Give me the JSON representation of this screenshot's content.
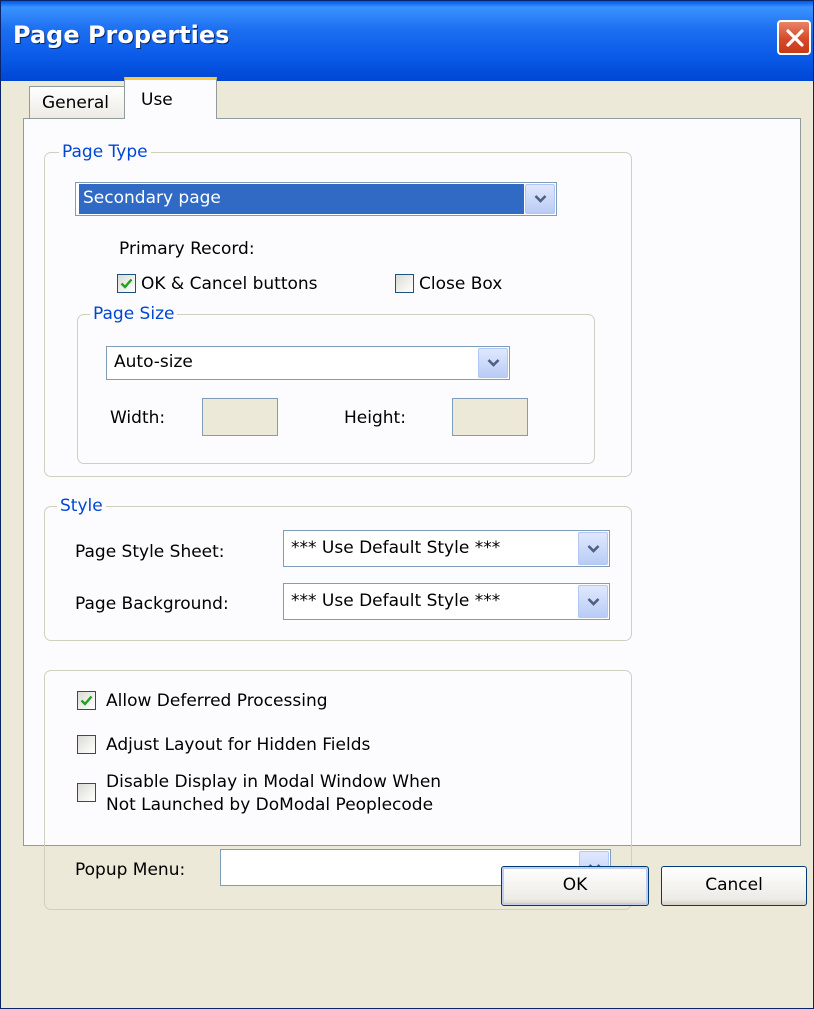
{
  "window": {
    "title": "Page Properties"
  },
  "tabs": {
    "general": "General",
    "use": "Use"
  },
  "page_type": {
    "legend": "Page Type",
    "type_value": "Secondary page",
    "primary_record_label": "Primary Record:",
    "ok_cancel_label": "OK & Cancel buttons",
    "ok_cancel_checked": true,
    "close_box_label": "Close Box",
    "close_box_checked": false
  },
  "page_size": {
    "legend": "Page Size",
    "size_value": "Auto-size",
    "width_label": "Width:",
    "height_label": "Height:",
    "width_value": "",
    "height_value": ""
  },
  "style": {
    "legend": "Style",
    "style_sheet_label": "Page Style Sheet:",
    "style_sheet_value": "*** Use Default Style ***",
    "background_label": "Page Background:",
    "background_value": "*** Use Default Style ***"
  },
  "options": {
    "allow_deferred_label": "Allow Deferred Processing",
    "allow_deferred_checked": true,
    "adjust_layout_label": "Adjust Layout for Hidden Fields",
    "adjust_layout_checked": false,
    "disable_modal_line1": "Disable Display in Modal Window When",
    "disable_modal_line2": "Not Launched by DoModal Peoplecode",
    "disable_modal_checked": false,
    "popup_menu_label": "Popup Menu:",
    "popup_menu_value": ""
  },
  "buttons": {
    "ok": "OK",
    "cancel": "Cancel"
  },
  "colors": {
    "titlebar": "#0a5ae8",
    "legend_text": "#0046d5",
    "selection": "#316ac5",
    "dialog_bg": "#ece9d8"
  },
  "icons": {
    "close": "close-icon",
    "dropdown": "chevron-down-icon",
    "check": "checkmark-icon"
  }
}
